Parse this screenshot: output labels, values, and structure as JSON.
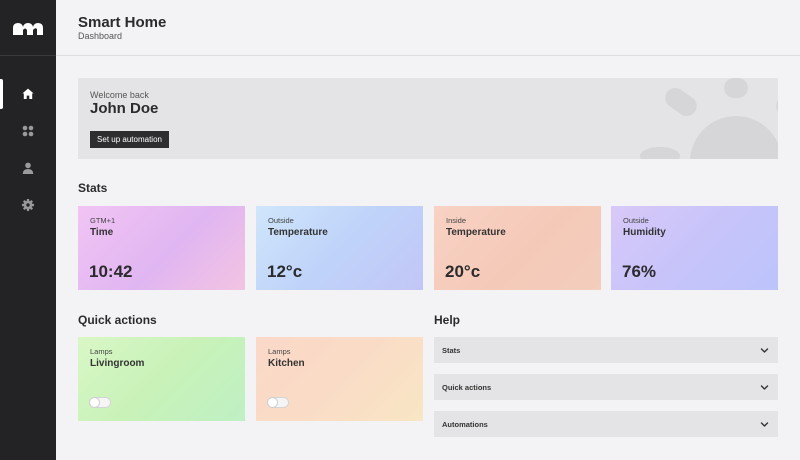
{
  "header": {
    "title": "Smart Home",
    "subtitle": "Dashboard"
  },
  "nav": {
    "items": [
      {
        "icon": "home-icon",
        "active": true
      },
      {
        "icon": "grid-icon",
        "active": false
      },
      {
        "icon": "user-icon",
        "active": false
      },
      {
        "icon": "gear-icon",
        "active": false
      }
    ]
  },
  "hero": {
    "welcome": "Welcome back",
    "name": "John Doe",
    "button_label": "Set up automation"
  },
  "stats": {
    "title": "Stats",
    "cards": [
      {
        "label": "GTM+1",
        "title": "Time",
        "value": "10:42"
      },
      {
        "label": "Outside",
        "title": "Temperature",
        "value": "12°c"
      },
      {
        "label": "Inside",
        "title": "Temperature",
        "value": "20°c"
      },
      {
        "label": "Outside",
        "title": "Humidity",
        "value": "76%"
      }
    ]
  },
  "quick_actions": {
    "title": "Quick actions",
    "cards": [
      {
        "label": "Lamps",
        "title": "Livingroom",
        "on": false
      },
      {
        "label": "Lamps",
        "title": "Kitchen",
        "on": false
      }
    ]
  },
  "help": {
    "title": "Help",
    "items": [
      {
        "label": "Stats"
      },
      {
        "label": "Quick actions"
      },
      {
        "label": "Automations"
      }
    ]
  },
  "colors": {
    "sidebar": "#232325",
    "background": "#f3f3f5",
    "panel": "#e4e4e6",
    "button": "#2e2e30"
  }
}
